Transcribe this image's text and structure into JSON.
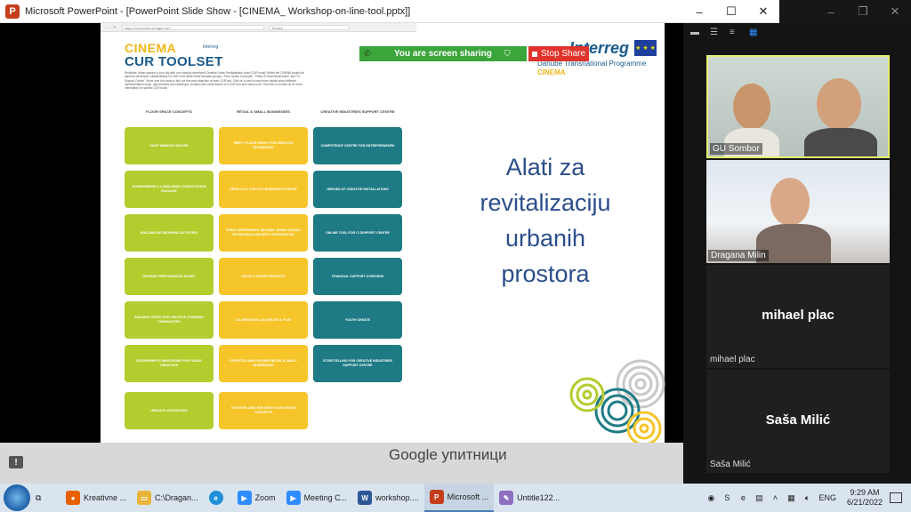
{
  "window": {
    "title": "Microsoft PowerPoint - [PowerPoint Slide Show - [CINEMA_ Workshop-on-line-tool.pptx]]",
    "minimize": "–",
    "maximize": "☐",
    "close": "✕"
  },
  "zoom_window": {
    "minimize": "–",
    "maximize": "❐",
    "close": "✕"
  },
  "slide": {
    "browser_url": "https://www.hdm-stuttgart.de/...",
    "browser_search": "Search",
    "cinema_logo": "CINEMA",
    "toolset_logo": "CUR TOOLSET",
    "small_interreg": "Interreg",
    "intro_text": "Revitalize Urban spaces in your city with our uniquely developed Creative Urban Revitalisation tools (CUR tools)! Within the CINEMA project all partners developed collaboratively 20 CUR tools within three thematic groups: \"Floor Space Concepts\", \"Retail & Small Businesses\" and \"CI Support Centre\". Move over the cards to find out the main objective of each CUR tool. Click on a card to read more details about different implementation steps, opportunities and challenges, duration and costs factors of a CUR tool and many more. Feel free to contact us for more information on specific CUR tools!",
    "columns": [
      "FLOOR SPACE CONCEPTS",
      "RETAIL & SMALL BUSINESSES",
      "CREATIVE INDUSTRIES SUPPORT CENTRE"
    ],
    "col1": [
      "SHOP WINDOW GRAVEN",
      "HOMEOWNERS & LANDLORDS CONSULTATION PACKAGE",
      "BUILDING NETWORKING ACTIVITIES",
      "OPENING PERFORMANCE MODEL",
      "BUILDING SPACE FOR CREATIVE LEARNING COMMUNITIES",
      "INTERNSHIPS & MENTORING FOR YOUNG CREATIVES",
      "URBAN PLAYGROUNDS"
    ],
    "col2": [
      "EMPTY FLOOR SPACE FOR CREATIVE BUSINESSES",
      "OPEN CALL FOR CITY BUSINESS STARTER",
      "EVENT, EXPERIENCE, BECOME: BRING SPACES OF BUILDING AND WITH COOPERATION",
      "SPACE & SPACE PROJECTS",
      "CO-CREATION LAB CREATE & PLAY",
      "STORYTELLING FOR NEW RETAIL & SMALL BUSINESSES",
      "STORYTELLING FOR NEW FLOOR SPACE CONCEPTS"
    ],
    "col3": [
      "COMPETENCE CENTRE FOR ENTREPRENEURS",
      "HEROES OF CREATIVE INSTALLATIONS",
      "ONLINE TOOL FOR CI SUPPORT CENTRE",
      "FINANCIAL SUPPORT OVERVIEW",
      "YOUTH CREATE",
      "STORYTELLING FOR CREATIVE INDUSTRIES SUPPORT CENTRE"
    ],
    "title_lines": [
      "Alati za",
      "revitalizaciju",
      "urbanih",
      "prostora"
    ],
    "interreg": "Interreg",
    "danube": "Danube Transnational Programme",
    "cinema_small": "CINEMA"
  },
  "share_banner": {
    "text": "You are screen sharing",
    "stop_label": "Stop Share"
  },
  "slidebar": {
    "google_text": "Google упитници"
  },
  "zoom": {
    "participants": [
      {
        "name": "GU Sombor"
      },
      {
        "name": "Dragana Milin"
      },
      {
        "name": "mihael plac",
        "label": "mihael plac"
      },
      {
        "name": "Saša Milić",
        "label": "Saša Milić"
      }
    ]
  },
  "taskbar": {
    "items": [
      "Kreativne ...",
      "C:\\Dragan...",
      "",
      "Zoom",
      "Meeting C...",
      "workshop....",
      "Microsoft ...",
      "Untitle122..."
    ],
    "lang": "ENG",
    "time": "9:29 AM",
    "date": "6/21/2022"
  },
  "colors": {
    "green_tile": "#b4cc2e",
    "yellow_tile": "#f5c52a",
    "teal_tile": "#1e7b85",
    "title_blue": "#2b4e8c",
    "share_green": "#3aa53a",
    "stop_red": "#e0332c"
  }
}
